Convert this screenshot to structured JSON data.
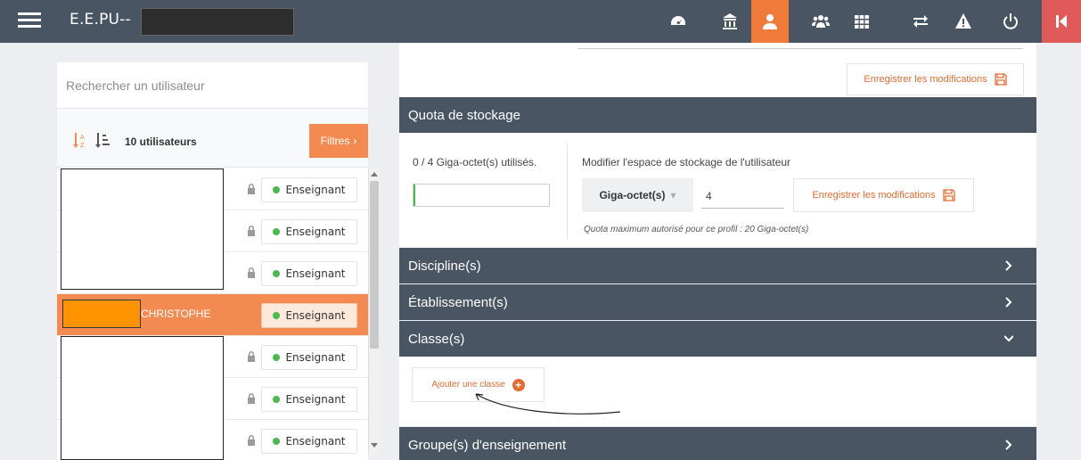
{
  "topbar": {
    "title": "E.E.PU--",
    "icons": [
      "dashboard-icon",
      "school-icon",
      "user-icon",
      "users-group-icon",
      "grid-icon",
      "exchange-icon",
      "warning-icon",
      "power-icon",
      "exit-icon"
    ],
    "accent_active": "#f07a3a",
    "bg": "#4a5563"
  },
  "sidebar": {
    "search_placeholder": "Rechercher un utilisateur",
    "user_count": "10 utilisateurs",
    "filters_label": "Filtres",
    "users": [
      {
        "name": "",
        "role": "Enseignant",
        "selected": false
      },
      {
        "name": "",
        "role": "Enseignant",
        "selected": false
      },
      {
        "name": "",
        "role": "Enseignant",
        "selected": false
      },
      {
        "name": "CHRISTOPHE",
        "role": "Enseignant",
        "selected": true
      },
      {
        "name": "",
        "role": "Enseignant",
        "selected": false
      },
      {
        "name": "",
        "role": "Enseignant",
        "selected": false
      },
      {
        "name": "",
        "role": "Enseignant",
        "selected": false
      }
    ]
  },
  "main": {
    "save_label": "Enregistrer les modifications",
    "quota": {
      "title": "Quota de stockage",
      "used_text": "0 / 4 Giga-octet(s) utilisés.",
      "used_fraction": 0.0,
      "modify_label": "Modifier l'espace de stockage de l'utilisateur",
      "unit": "Giga-octet(s)",
      "value": "4",
      "save_label": "Enregistrer les modifications",
      "max_text": "Quota maximum autorisé pour ce profil : 20 Giga-octet(s)"
    },
    "sections": {
      "disciplines": "Discipline(s)",
      "etablissements": "Établissement(s)",
      "classes": "Classe(s)",
      "groupes": "Groupe(s) d'enseignement"
    },
    "add_class_label": "Ajouter une classe"
  }
}
